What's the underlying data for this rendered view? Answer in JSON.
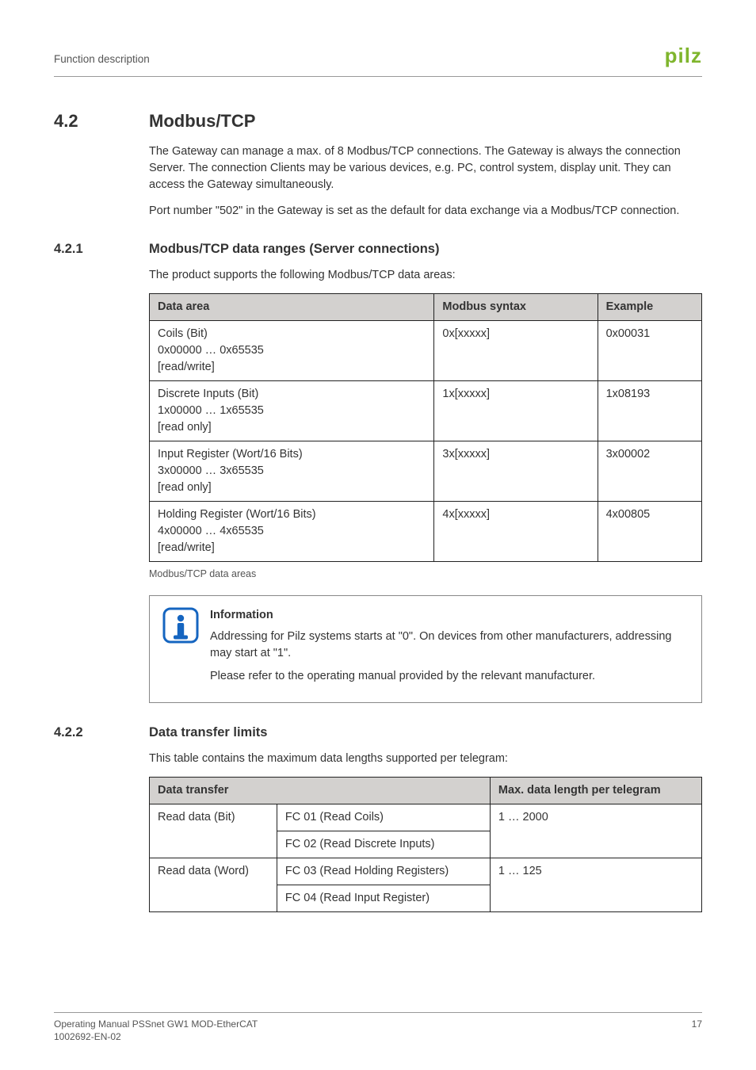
{
  "header": {
    "section_label": "Function description",
    "logo_text": "pilz"
  },
  "sec42": {
    "num": "4.2",
    "title": "Modbus/TCP",
    "p1": "The Gateway can manage a max. of 8 Modbus/TCP connections. The Gateway is always the connection Server. The connection Clients may be various devices, e.g. PC, control system, display unit. They can access the Gateway simultaneously.",
    "p2": "Port number \"502\" in the Gateway is set as the default for data exchange via a Modbus/TCP connection."
  },
  "sec421": {
    "num": "4.2.1",
    "title": "Modbus/TCP data ranges (Server connections)",
    "intro": "The product supports the following Modbus/TCP data areas:",
    "table": {
      "headers": [
        "Data area",
        "Modbus syntax",
        "Example"
      ],
      "rows": [
        {
          "c0": "Coils (Bit)\n0x00000 … 0x65535\n[read/write]",
          "c1": "0x[xxxxx]",
          "c2": "0x00031"
        },
        {
          "c0": "Discrete Inputs (Bit)\n1x00000 … 1x65535\n[read only]",
          "c1": "1x[xxxxx]",
          "c2": "1x08193"
        },
        {
          "c0": "Input Register (Wort/16 Bits)\n3x00000 … 3x65535\n[read only]",
          "c1": "3x[xxxxx]",
          "c2": "3x00002"
        },
        {
          "c0": "Holding Register (Wort/16 Bits)\n4x00000 … 4x65535\n[read/write]",
          "c1": "4x[xxxxx]",
          "c2": "4x00805"
        }
      ],
      "caption": "Modbus/TCP data areas"
    },
    "info": {
      "title": "Information",
      "p1": "Addressing for Pilz systems starts at \"0\". On devices from other manufacturers, addressing may start at \"1\".",
      "p2": "Please refer to the operating manual provided by the relevant manufacturer."
    }
  },
  "sec422": {
    "num": "4.2.2",
    "title": "Data transfer limits",
    "intro": "This table contains the maximum data lengths supported per telegram:",
    "table": {
      "headers": [
        "Data transfer",
        "",
        "Max. data length per telegram"
      ],
      "rows": [
        {
          "c0": "Read data (Bit)",
          "c1": "FC 01 (Read Coils)",
          "c2": "1 … 2000",
          "rs0": 2
        },
        {
          "c1": "FC 02 (Read Discrete Inputs)",
          "c2": "",
          "rs2_skip": true
        },
        {
          "c0": "Read data (Word)",
          "c1": "FC 03 (Read Holding Registers)",
          "c2": "1 … 125",
          "rs0": 2
        },
        {
          "c1": "FC 04 (Read Input Register)",
          "c2": "",
          "rs2_skip": true
        }
      ]
    }
  },
  "footer": {
    "line1": "Operating Manual PSSnet GW1 MOD-EtherCAT",
    "line2": "1002692-EN-02",
    "page": "17"
  }
}
